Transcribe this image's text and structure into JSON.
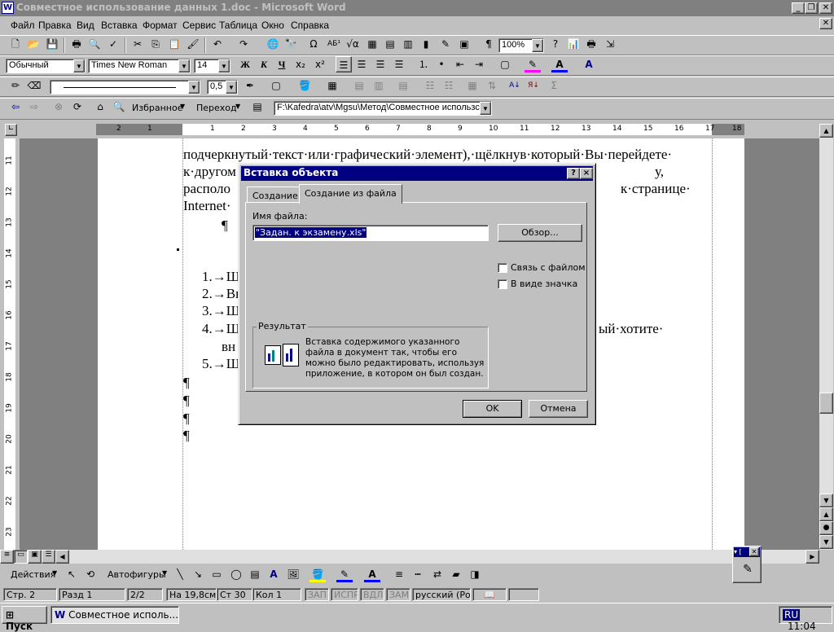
{
  "window": {
    "title": "Совместное использование данных 1.doc - Microsoft Word"
  },
  "menu": [
    "Файл",
    "Правка",
    "Вид",
    "Вставка",
    "Формат",
    "Сервис",
    "Таблица",
    "Окно",
    "Справка"
  ],
  "formatting": {
    "style": "Обычный",
    "font": "Times New Roman",
    "size": "14",
    "bold": "Ж",
    "italic": "К",
    "underline": "Ч"
  },
  "standard": {
    "zoom": "100%"
  },
  "drawing_line": {
    "width": "0,5"
  },
  "web": {
    "favorites": "Избранное",
    "goto": "Переход",
    "address": "F:\\Kafedra\\atv\\Mgsu\\Метод\\Совместное использс"
  },
  "ruler": {
    "h_ticks": [
      "2",
      "1",
      "1",
      "2",
      "3",
      "4",
      "5",
      "6",
      "7",
      "8",
      "9",
      "10",
      "11",
      "12",
      "13",
      "14",
      "15",
      "16",
      "17",
      "18"
    ],
    "v_ticks": [
      "11",
      "12",
      "13",
      "14",
      "15",
      "16",
      "17",
      "18",
      "19",
      "20",
      "21",
      "22",
      "23"
    ]
  },
  "document": {
    "lines": [
      "подчеркнутый·текст·или·графический·элемент),·щёлкнув·который·Вы·перейдете·",
      "к·другом",
      "располо",
      "Internet·",
      "¶",
      "1.→Щ",
      "2.→Вы",
      "3.→Щ",
      "4.→Щ",
      "вн",
      "5.→Щ",
      "¶",
      "¶",
      "¶",
      "¶"
    ],
    "right_frag": [
      "у,",
      "к·странице·",
      "ый·хотите·"
    ]
  },
  "dialog": {
    "title": "Вставка объекта",
    "help": "?",
    "close": "×",
    "tabs": [
      "Создание",
      "Создание из файла"
    ],
    "filename_label": "Имя файла:",
    "filename_value": "\"Задан. к экзамену.xls\"",
    "browse": "Обзор...",
    "link_label": "Связь с файлом",
    "icon_label": "В виде значка",
    "result_title": "Результат",
    "result_text": "Вставка содержимого указанного файла в документ так, чтобы его можно было редактировать, используя приложение, в котором он был создан.",
    "ok": "OK",
    "cancel": "Отмена"
  },
  "drawing": {
    "actions": "Действия",
    "autoshapes": "Автофигуры"
  },
  "status": {
    "page": "Стр. 2",
    "section": "Разд 1",
    "pages": "2/2",
    "pos": "На 19,8см",
    "line": "Ст 30",
    "col": "Кол 1",
    "rec": "ЗАП",
    "trk": "ИСПР",
    "ext": "ВДЛ",
    "ovr": "ЗАМ",
    "lang": "русский (Ро"
  },
  "taskbar": {
    "start": "Пуск",
    "task": "Совместное исполь...",
    "lang": "RU",
    "time": "11:04"
  }
}
